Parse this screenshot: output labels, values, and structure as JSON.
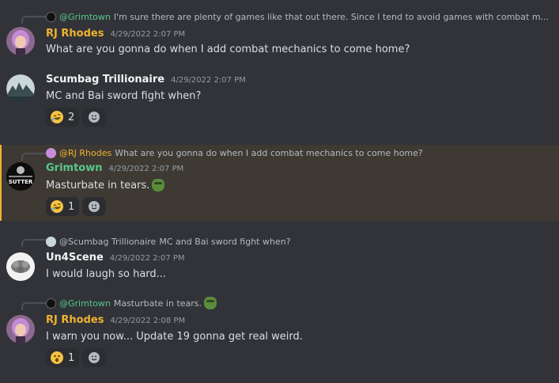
{
  "colors": {
    "rj": "#f0b232",
    "grimtown": "#57c78b",
    "scumbag": "#f2f3f5",
    "un4scene": "#f2f3f5",
    "mention_bg": "#3e3a33",
    "mention_bar": "#f0b232"
  },
  "messages": [
    {
      "reply": {
        "name": "@Grimtown",
        "text": "I'm sure there are plenty of games like that out there. Since I tend to avoid games with combat m..."
      },
      "author": "RJ Rhodes",
      "timestamp": "4/29/2022 2:07 PM",
      "text": "What are you gonna do when I add combat mechanics to come home?"
    },
    {
      "author": "Scumbag Trillionaire",
      "timestamp": "4/29/2022 2:07 PM",
      "text": "MC and Bai sword fight when?",
      "reaction": {
        "emoji": "rolling-on-floor-laughing",
        "count": "2"
      }
    },
    {
      "reply": {
        "name": "@RJ Rhodes",
        "text": "What are you gonna do when I add combat mechanics to come home?"
      },
      "author": "Grimtown",
      "avatar_text": "SUTTER",
      "timestamp": "4/29/2022 2:07 PM",
      "text": "Masturbate in tears.",
      "reaction": {
        "emoji": "rolling-on-floor-laughing",
        "count": "1"
      }
    },
    {
      "reply": {
        "name": "@Scumbag Trillionaire",
        "text": "MC and Bai sword fight when?"
      },
      "author": "Un4Scene",
      "timestamp": "4/29/2022 2:07 PM",
      "text": "I would laugh so hard..."
    },
    {
      "reply": {
        "name": "@Grimtown",
        "text": "Masturbate in tears."
      },
      "author": "RJ Rhodes",
      "timestamp": "4/29/2022 2:08 PM",
      "text": "I warn you now... Update 19 gonna get real weird.",
      "reaction": {
        "emoji": "astonished-face",
        "count": "1"
      }
    }
  ]
}
